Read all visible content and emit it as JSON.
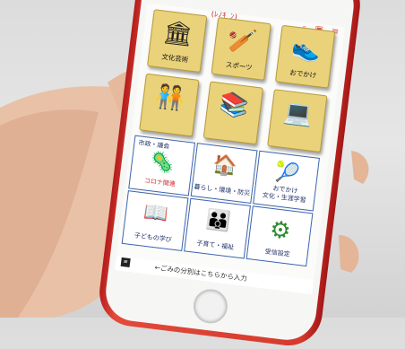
{
  "app": {
    "header_title": "(ﾚﾉｷﾞﾝ)",
    "header_icons": [
      "search-icon",
      "bookmark-icon",
      "menu-icon"
    ]
  },
  "gold_tiles": [
    {
      "label": "文化芸術",
      "icon": "🏛"
    },
    {
      "label": "スポーツ",
      "icon": "🏏"
    },
    {
      "label": "おでかけ",
      "icon": "👟"
    },
    {
      "label": "",
      "icon": "🧑‍🤝‍🧑"
    },
    {
      "label": "",
      "icon": "📚"
    },
    {
      "label": "",
      "icon": "💻"
    }
  ],
  "blue_tiles": [
    {
      "line1": "市政・議会",
      "line2": "コロナ関連",
      "icon": "🦠"
    },
    {
      "line1": "暮らし・環境・防災",
      "line2": "",
      "icon": "🏠"
    },
    {
      "line1": "おでかけ",
      "line2": "文化・生涯学習",
      "icon": "🎾"
    },
    {
      "line1": "子どもの学び",
      "line2": "",
      "icon": "📖"
    },
    {
      "line1": "子育て・福祉",
      "line2": "",
      "icon": "👪"
    },
    {
      "line1": "受信設定",
      "line2": "",
      "icon": "⚙"
    }
  ],
  "bottom_bar": {
    "text": "←ごみの分別はこちらから入力",
    "menu_label": "≡"
  },
  "colors": {
    "phone": "#d53a2e",
    "gold": "#e9d27a",
    "blue_border": "#3b64b0",
    "gear": "#2e8b2e",
    "corona": "#d03030"
  }
}
